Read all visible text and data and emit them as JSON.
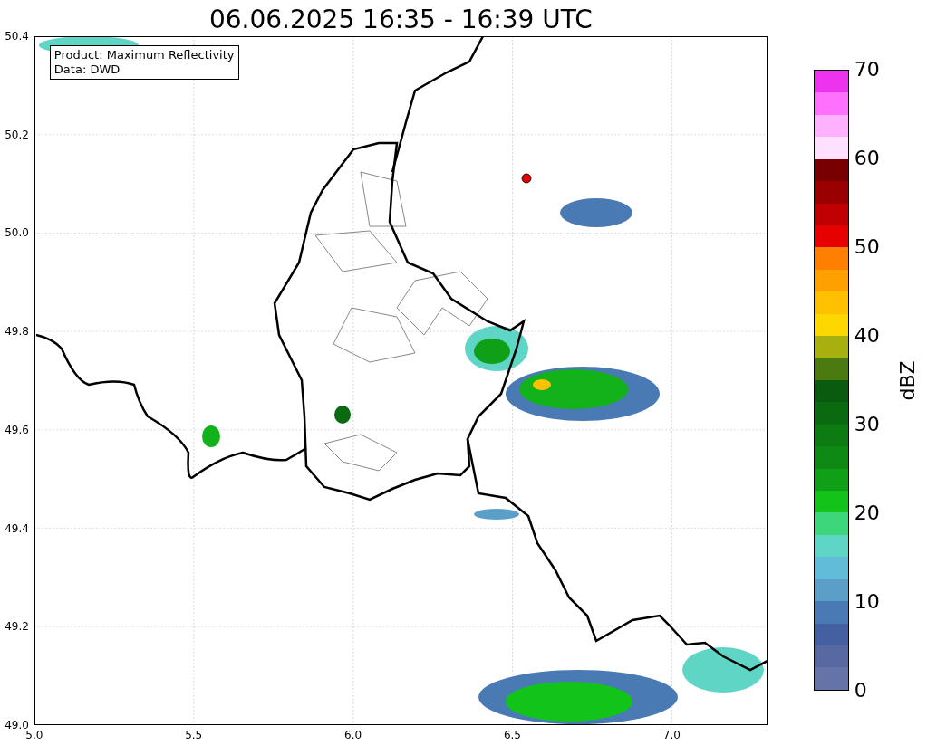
{
  "title": "06.06.2025 16:35 - 16:39 UTC",
  "info_box": {
    "lines": [
      "Product: Maximum Reflectivity",
      "Data: DWD"
    ]
  },
  "y_ticks": [
    "50.4",
    "50.2",
    "50.0",
    "49.8",
    "49.6",
    "49.4",
    "49.2",
    "49.0"
  ],
  "x_ticks": [
    "5.0",
    "5.5",
    "6.0",
    "6.5",
    "7.0"
  ],
  "colorbar": {
    "label": "dBZ",
    "ticks": [
      "70",
      "60",
      "50",
      "40",
      "30",
      "20",
      "10",
      "0"
    ],
    "segments": [
      {
        "color": "#ee33ee"
      },
      {
        "color": "#ff70ff"
      },
      {
        "color": "#ffb0ff"
      },
      {
        "color": "#ffe0ff"
      },
      {
        "color": "#780000"
      },
      {
        "color": "#9a0000"
      },
      {
        "color": "#c00000"
      },
      {
        "color": "#e60000"
      },
      {
        "color": "#ff8000"
      },
      {
        "color": "#ffa000"
      },
      {
        "color": "#ffc000"
      },
      {
        "color": "#ffd700"
      },
      {
        "color": "#a8b010"
      },
      {
        "color": "#4a7a10"
      },
      {
        "color": "#0a5a10"
      },
      {
        "color": "#0a6a10"
      },
      {
        "color": "#0e7a12"
      },
      {
        "color": "#0e8a14"
      },
      {
        "color": "#10a017"
      },
      {
        "color": "#12c41a"
      },
      {
        "color": "#3dd67a"
      },
      {
        "color": "#5fd5c6"
      },
      {
        "color": "#60bcd8"
      },
      {
        "color": "#5b9ec8"
      },
      {
        "color": "#4a7ab4"
      },
      {
        "color": "#4560a0"
      },
      {
        "color": "#5868a3"
      },
      {
        "color": "#6474a8"
      }
    ]
  }
}
